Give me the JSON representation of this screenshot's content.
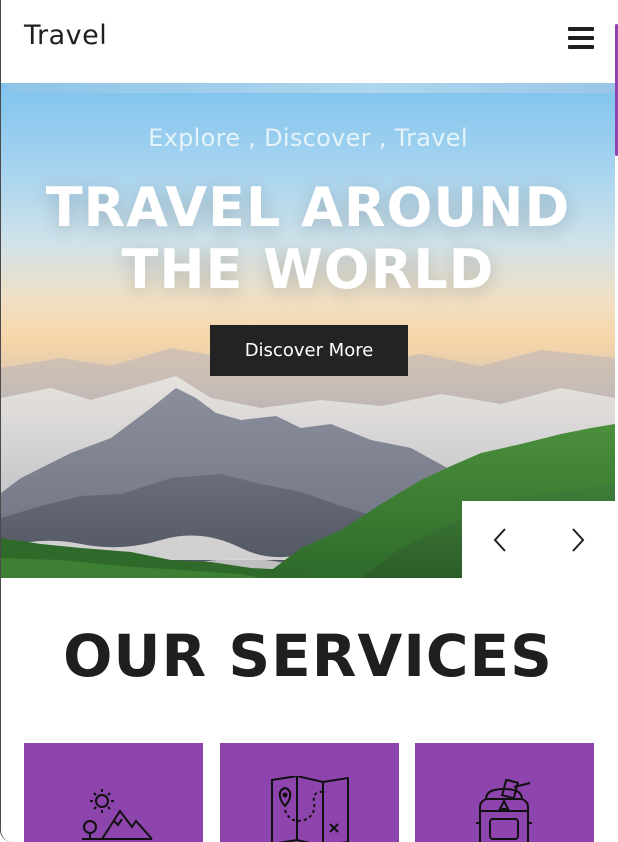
{
  "header": {
    "brand": "Travel",
    "menu_icon": "hamburger-menu-icon"
  },
  "hero": {
    "subtitle": "Explore , Discover , Travel",
    "title_line1": "TRAVEL AROUND",
    "title_line2": "THE WORLD",
    "cta_label": "Discover More",
    "prev_icon": "chevron-left-icon",
    "next_icon": "chevron-right-icon"
  },
  "services": {
    "title": "OUR SERVICES",
    "cards": [
      {
        "icon": "sun-mountains-icon"
      },
      {
        "icon": "map-route-icon"
      },
      {
        "icon": "backpack-icon"
      }
    ]
  },
  "colors": {
    "accent": "#8e44ad",
    "dark": "#232323",
    "text": "#1f1f1f"
  }
}
